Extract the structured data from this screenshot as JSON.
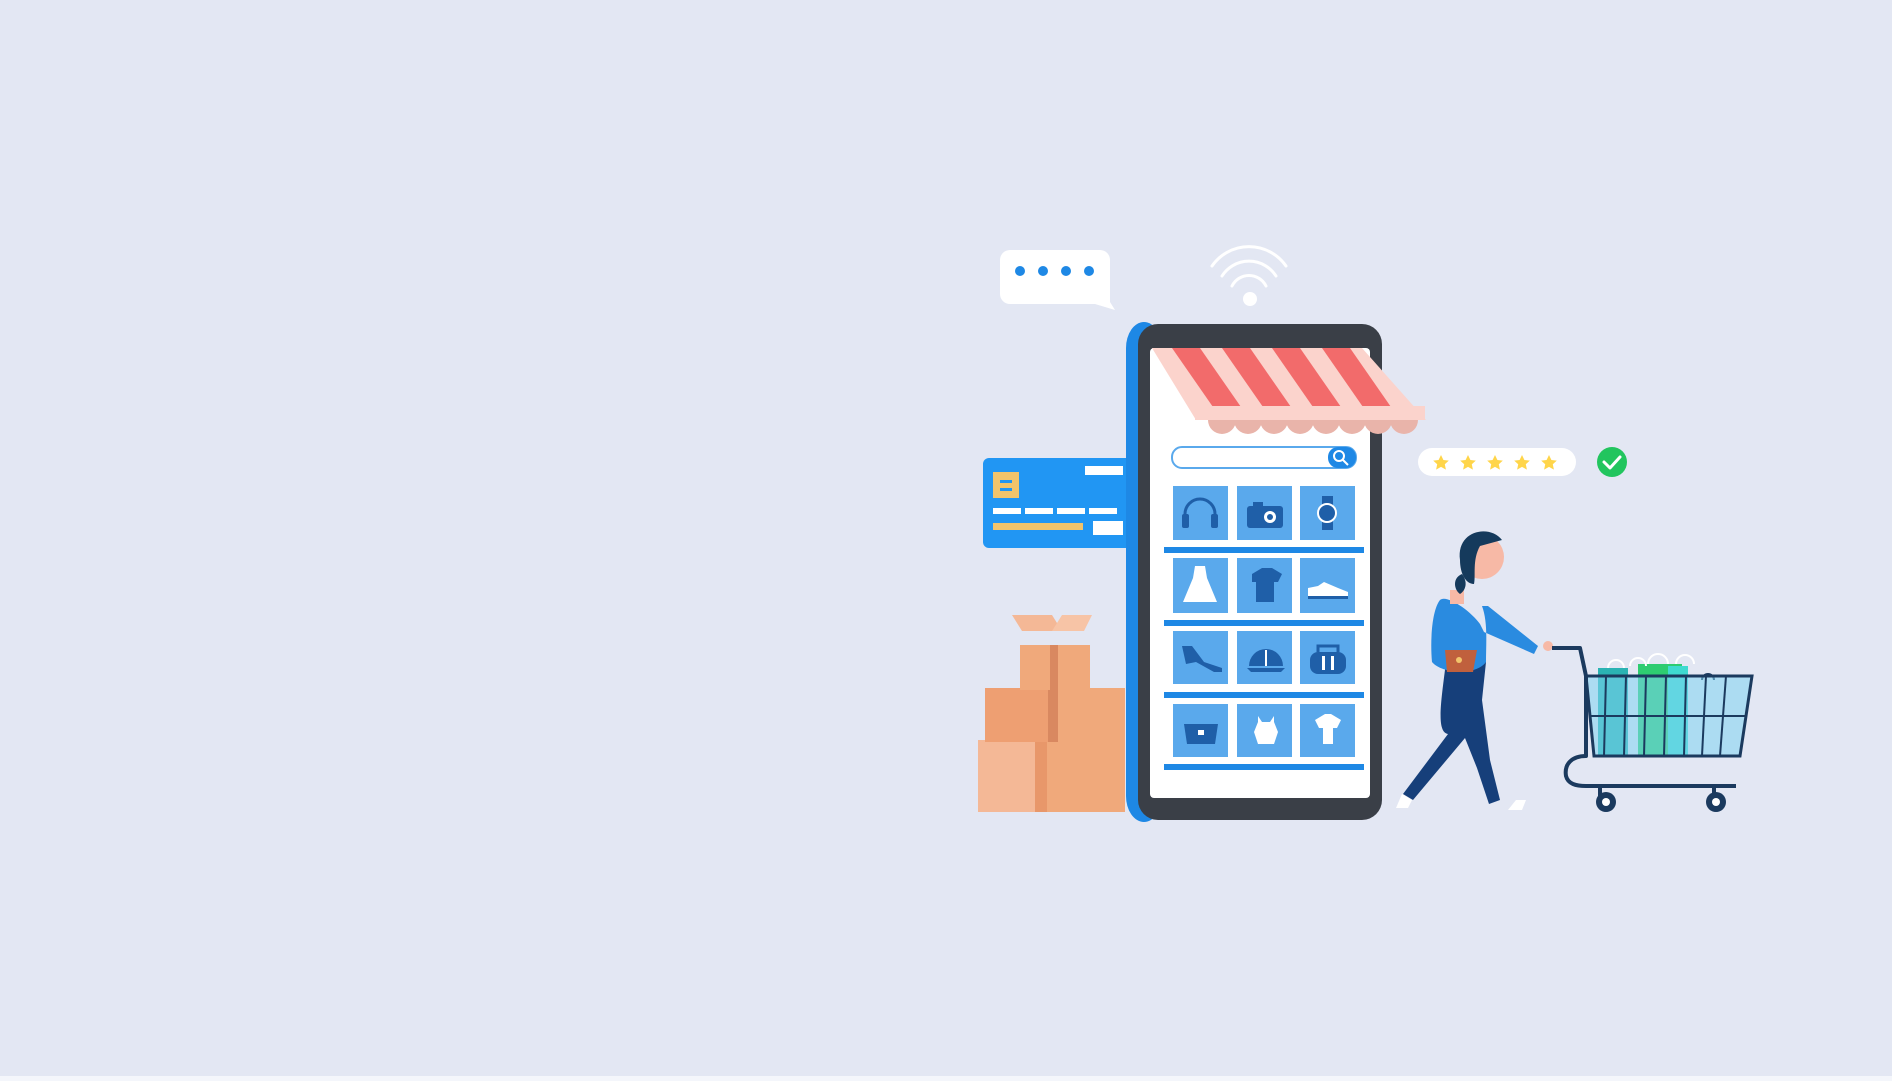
{
  "illustration": {
    "subject": "online-shopping",
    "colors": {
      "background": "#e3e7f3",
      "phone_body": "#3a3f47",
      "phone_side": "#1e88e5",
      "screen": "#ffffff",
      "awning_red": "#f26b6b",
      "awning_light": "#fbd3cc",
      "tile": "#5aa9ec",
      "tile_icon": "#1f5fa8",
      "shelf": "#1e88e5",
      "card": "#2196f3",
      "card_chip": "#f2c46b",
      "box": "#f0a97b",
      "person_shirt": "#2a8be0",
      "person_pants": "#163f7a",
      "hair": "#153a5c",
      "skin": "#f7b9a6",
      "cart": "#1b3a5e",
      "cart_basket": "#7fd4f0",
      "bag_green": "#2ecc71",
      "bag_teal": "#2bb3b3",
      "star": "#ffd54a",
      "check": "#22c55e"
    },
    "rating": {
      "stars": 5,
      "max": 5
    },
    "product_icons": [
      "headphones-icon",
      "camera-icon",
      "watch-icon",
      "dress-icon",
      "tshirt-icon",
      "sneaker-icon",
      "high-heel-icon",
      "cap-icon",
      "bag-icon",
      "purse-icon",
      "top-icon",
      "shirt-icon"
    ]
  }
}
